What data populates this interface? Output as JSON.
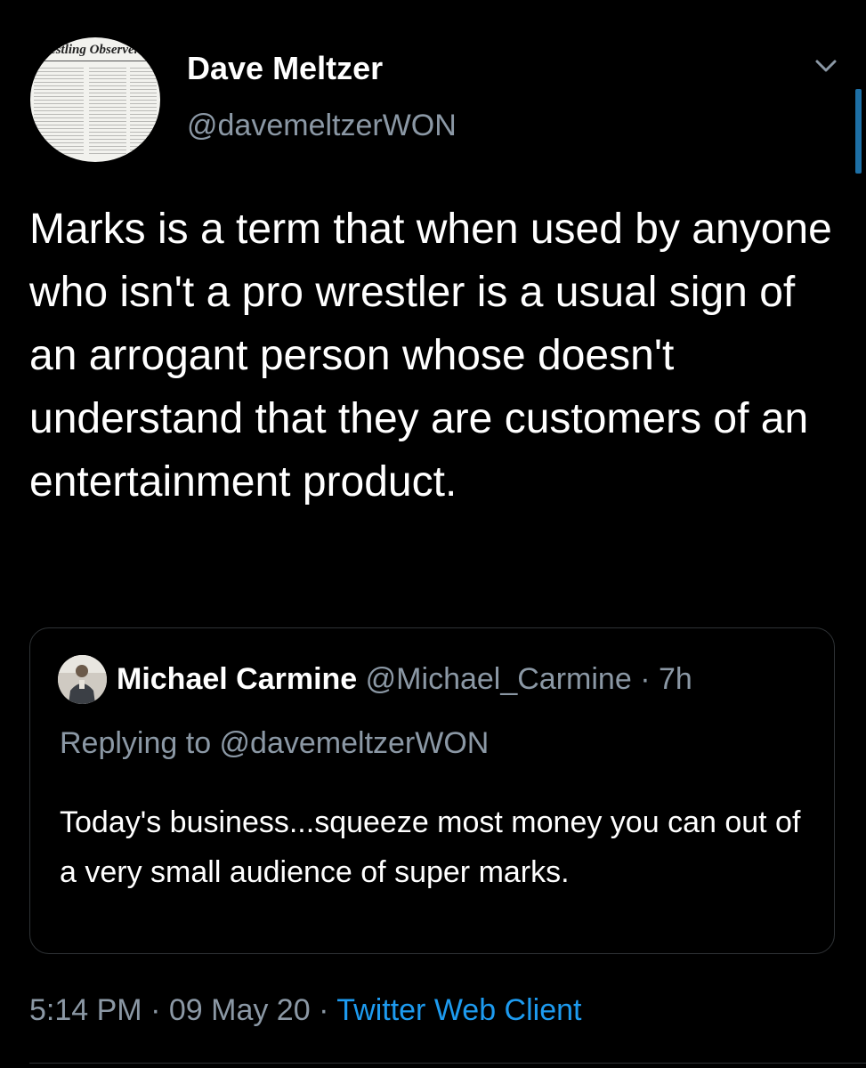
{
  "author": {
    "name": "Dave Meltzer",
    "handle": "@davemeltzerWON",
    "avatar_icon": "newspaper-avatar",
    "avatar_text": "Wrestling Observer News"
  },
  "tweet": {
    "text": "Marks is a term that when used by anyone who isn't a pro wrestler is a usual sign of an arrogant person whose doesn't understand that they are customers of an entertainment product."
  },
  "quoted_tweet": {
    "name": "Michael Carmine",
    "handle": "@Michael_Carmine",
    "separator": "·",
    "time": "7h",
    "replying_to": "Replying to @davemeltzerWON",
    "text": "Today's business...squeeze most money you can out of a very small audience of super marks."
  },
  "meta": {
    "time": "5:14 PM",
    "sep1": "·",
    "date": "09 May 20",
    "sep2": "·",
    "client": "Twitter Web Client"
  },
  "icons": {
    "menu": "chevron-down-icon"
  },
  "colors": {
    "background": "#000000",
    "primary_text": "#ffffff",
    "secondary_text": "#8b98a5",
    "link": "#1d9bf0",
    "border": "#2f3336"
  }
}
